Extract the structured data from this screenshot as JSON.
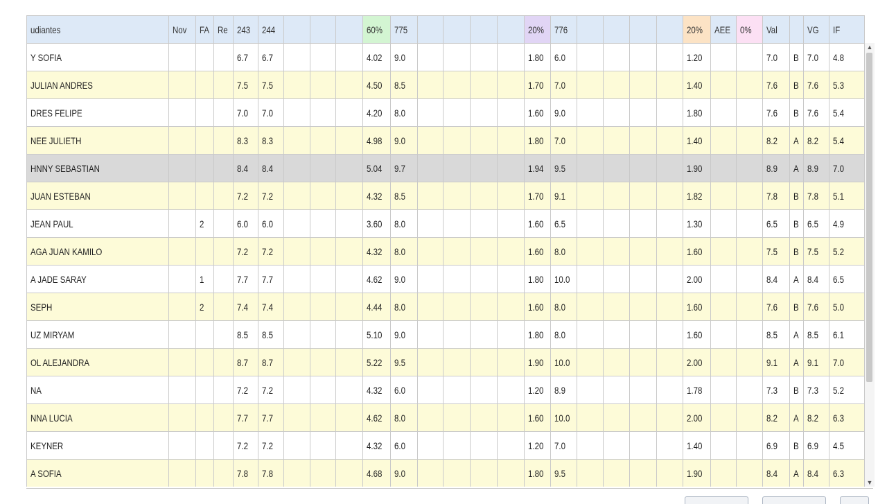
{
  "headers": [
    "udiantes",
    "Nov",
    "FA",
    "Re",
    "243",
    "244",
    "",
    "",
    "",
    "60%",
    "775",
    "",
    "",
    "",
    "",
    "20%",
    "776",
    "",
    "",
    "",
    "",
    "20%",
    "AEE",
    "0%",
    "Val",
    "",
    "VG",
    "IF"
  ],
  "rows": [
    {
      "name": "Y SOFIA",
      "fa": "",
      "v243": "6.7",
      "v244": "6.7",
      "p60": "4.02",
      "v775": "9.0",
      "p20a": "1.80",
      "v776": "6.0",
      "p20b": "1.20",
      "val": "7.0",
      "letter": "B",
      "vg": "7.0",
      "if": "4.8"
    },
    {
      "name": "JULIAN ANDRES",
      "fa": "",
      "v243": "7.5",
      "v244": "7.5",
      "p60": "4.50",
      "v775": "8.5",
      "p20a": "1.70",
      "v776": "7.0",
      "p20b": "1.40",
      "val": "7.6",
      "letter": "B",
      "vg": "7.6",
      "if": "5.3"
    },
    {
      "name": "DRES FELIPE",
      "fa": "",
      "v243": "7.0",
      "v244": "7.0",
      "p60": "4.20",
      "v775": "8.0",
      "p20a": "1.60",
      "v776": "9.0",
      "p20b": "1.80",
      "val": "7.6",
      "letter": "B",
      "vg": "7.6",
      "if": "5.4"
    },
    {
      "name": "NEE JULIETH",
      "fa": "",
      "v243": "8.3",
      "v244": "8.3",
      "p60": "4.98",
      "v775": "9.0",
      "p20a": "1.80",
      "v776": "7.0",
      "p20b": "1.40",
      "val": "8.2",
      "letter": "A",
      "vg": "8.2",
      "if": "5.4"
    },
    {
      "name": "HNNY SEBASTIAN",
      "fa": "",
      "v243": "8.4",
      "v244": "8.4",
      "p60": "5.04",
      "v775": "9.7",
      "p20a": "1.94",
      "v776": "9.5",
      "p20b": "1.90",
      "val": "8.9",
      "letter": "A",
      "vg": "8.9",
      "if": "7.0"
    },
    {
      "name": "JUAN ESTEBAN",
      "fa": "",
      "v243": "7.2",
      "v244": "7.2",
      "p60": "4.32",
      "v775": "8.5",
      "p20a": "1.70",
      "v776": "9.1",
      "p20b": "1.82",
      "val": "7.8",
      "letter": "B",
      "vg": "7.8",
      "if": "5.1"
    },
    {
      "name": "JEAN PAUL",
      "fa": "2",
      "v243": "6.0",
      "v244": "6.0",
      "p60": "3.60",
      "v775": "8.0",
      "p20a": "1.60",
      "v776": "6.5",
      "p20b": "1.30",
      "val": "6.5",
      "letter": "B",
      "vg": "6.5",
      "if": "4.9"
    },
    {
      "name": "AGA JUAN KAMILO",
      "fa": "",
      "v243": "7.2",
      "v244": "7.2",
      "p60": "4.32",
      "v775": "8.0",
      "p20a": "1.60",
      "v776": "8.0",
      "p20b": "1.60",
      "val": "7.5",
      "letter": "B",
      "vg": "7.5",
      "if": "5.2"
    },
    {
      "name": "A JADE SARAY",
      "fa": "1",
      "v243": "7.7",
      "v244": "7.7",
      "p60": "4.62",
      "v775": "9.0",
      "p20a": "1.80",
      "v776": "10.0",
      "p20b": "2.00",
      "val": "8.4",
      "letter": "A",
      "vg": "8.4",
      "if": "6.5"
    },
    {
      "name": "SEPH",
      "fa": "2",
      "v243": "7.4",
      "v244": "7.4",
      "p60": "4.44",
      "v775": "8.0",
      "p20a": "1.60",
      "v776": "8.0",
      "p20b": "1.60",
      "val": "7.6",
      "letter": "B",
      "vg": "7.6",
      "if": "5.0"
    },
    {
      "name": "UZ MIRYAM",
      "fa": "",
      "v243": "8.5",
      "v244": "8.5",
      "p60": "5.10",
      "v775": "9.0",
      "p20a": "1.80",
      "v776": "8.0",
      "p20b": "1.60",
      "val": "8.5",
      "letter": "A",
      "vg": "8.5",
      "if": "6.1"
    },
    {
      "name": "OL ALEJANDRA",
      "fa": "",
      "v243": "8.7",
      "v244": "8.7",
      "p60": "5.22",
      "v775": "9.5",
      "p20a": "1.90",
      "v776": "10.0",
      "p20b": "2.00",
      "val": "9.1",
      "letter": "A",
      "vg": "9.1",
      "if": "7.0"
    },
    {
      "name": "NA",
      "fa": "",
      "v243": "7.2",
      "v244": "7.2",
      "p60": "4.32",
      "v775": "6.0",
      "p20a": "1.20",
      "v776": "8.9",
      "p20b": "1.78",
      "val": "7.3",
      "letter": "B",
      "vg": "7.3",
      "if": "5.2"
    },
    {
      "name": "NNA LUCIA",
      "fa": "",
      "v243": "7.7",
      "v244": "7.7",
      "p60": "4.62",
      "v775": "8.0",
      "p20a": "1.60",
      "v776": "10.0",
      "p20b": "2.00",
      "val": "8.2",
      "letter": "A",
      "vg": "8.2",
      "if": "6.3"
    },
    {
      "name": "KEYNER",
      "fa": "",
      "v243": "7.2",
      "v244": "7.2",
      "p60": "4.32",
      "v775": "6.0",
      "p20a": "1.20",
      "v776": "7.0",
      "p20b": "1.40",
      "val": "6.9",
      "letter": "B",
      "vg": "6.9",
      "if": "4.5"
    },
    {
      "name": "A SOFIA",
      "fa": "",
      "v243": "7.8",
      "v244": "7.8",
      "p60": "4.68",
      "v775": "9.0",
      "p20a": "1.80",
      "v776": "9.5",
      "p20b": "1.90",
      "val": "8.4",
      "letter": "A",
      "vg": "8.4",
      "if": "6.3"
    }
  ],
  "row_styles": [
    "plain",
    "band",
    "plain",
    "band",
    "selected",
    "band",
    "plain",
    "band",
    "plain",
    "band",
    "plain",
    "band",
    "plain",
    "band",
    "plain",
    "band"
  ],
  "colors": {
    "header": "#dde9f7",
    "band": "#fdfbd8",
    "selected": "#d9d9d9",
    "green": "#d3f5d2",
    "purple": "#e1d5f5",
    "orange": "#fce3c5",
    "pink": "#fce0f4"
  },
  "icons": {
    "scroll_up": "chevron-up-icon",
    "scroll_down": "chevron-down-icon"
  }
}
